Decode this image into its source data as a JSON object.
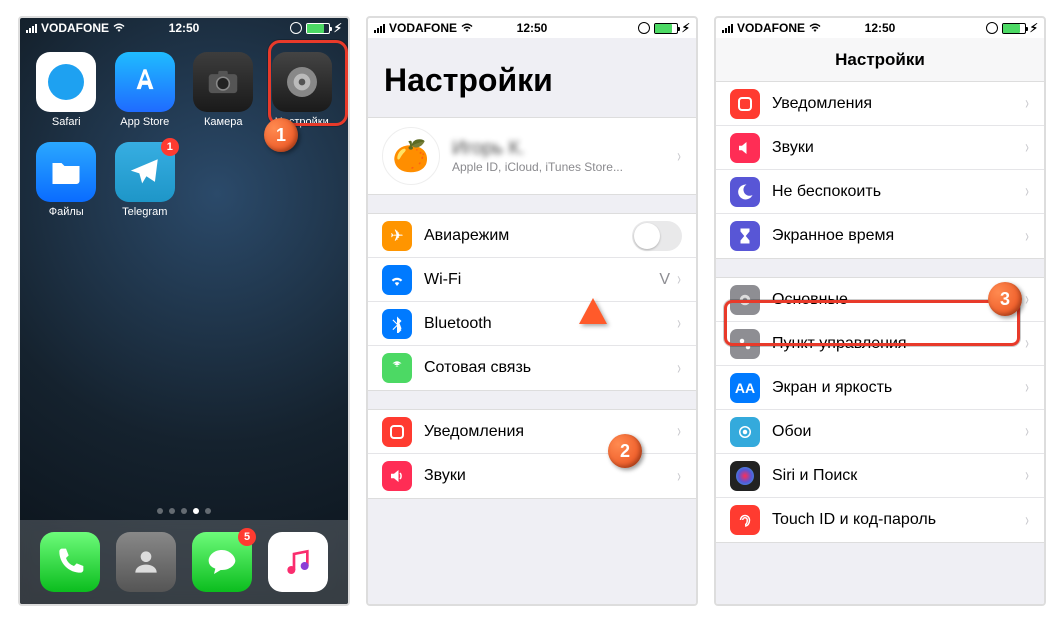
{
  "status": {
    "carrier": "VODAFONE",
    "time": "12:50"
  },
  "phone1": {
    "apps": [
      {
        "label": "Safari"
      },
      {
        "label": "App Store"
      },
      {
        "label": "Камера"
      },
      {
        "label": "Настройки"
      },
      {
        "label": "Файлы"
      },
      {
        "label": "Telegram",
        "badge": "1"
      }
    ],
    "dock_badges": {
      "messages": "5"
    },
    "marker": "1"
  },
  "phone2": {
    "title": "Настройки",
    "apple_id": {
      "name": "Игорь К.",
      "sub": "Apple ID, iCloud, iTunes Store..."
    },
    "items1": [
      {
        "key": "airplane",
        "label": "Авиарежим"
      },
      {
        "key": "wifi",
        "label": "Wi-Fi",
        "value": "V"
      },
      {
        "key": "bluetooth",
        "label": "Bluetooth"
      },
      {
        "key": "cellular",
        "label": "Сотовая связь"
      }
    ],
    "items2": [
      {
        "key": "notifications",
        "label": "Уведомления"
      },
      {
        "key": "sounds",
        "label": "Звуки"
      }
    ],
    "marker": "2"
  },
  "phone3": {
    "title": "Настройки",
    "items1": [
      {
        "key": "notifications",
        "label": "Уведомления"
      },
      {
        "key": "sounds",
        "label": "Звуки"
      },
      {
        "key": "dnd",
        "label": "Не беспокоить"
      },
      {
        "key": "screentime",
        "label": "Экранное время"
      }
    ],
    "items2": [
      {
        "key": "general",
        "label": "Основные"
      },
      {
        "key": "controlcenter",
        "label": "Пункт управления"
      },
      {
        "key": "display",
        "label": "Экран и яркость"
      },
      {
        "key": "wallpaper",
        "label": "Обои"
      },
      {
        "key": "siri",
        "label": "Siri и Поиск"
      },
      {
        "key": "touchid",
        "label": "Touch ID и код-пароль"
      }
    ],
    "marker": "3"
  }
}
